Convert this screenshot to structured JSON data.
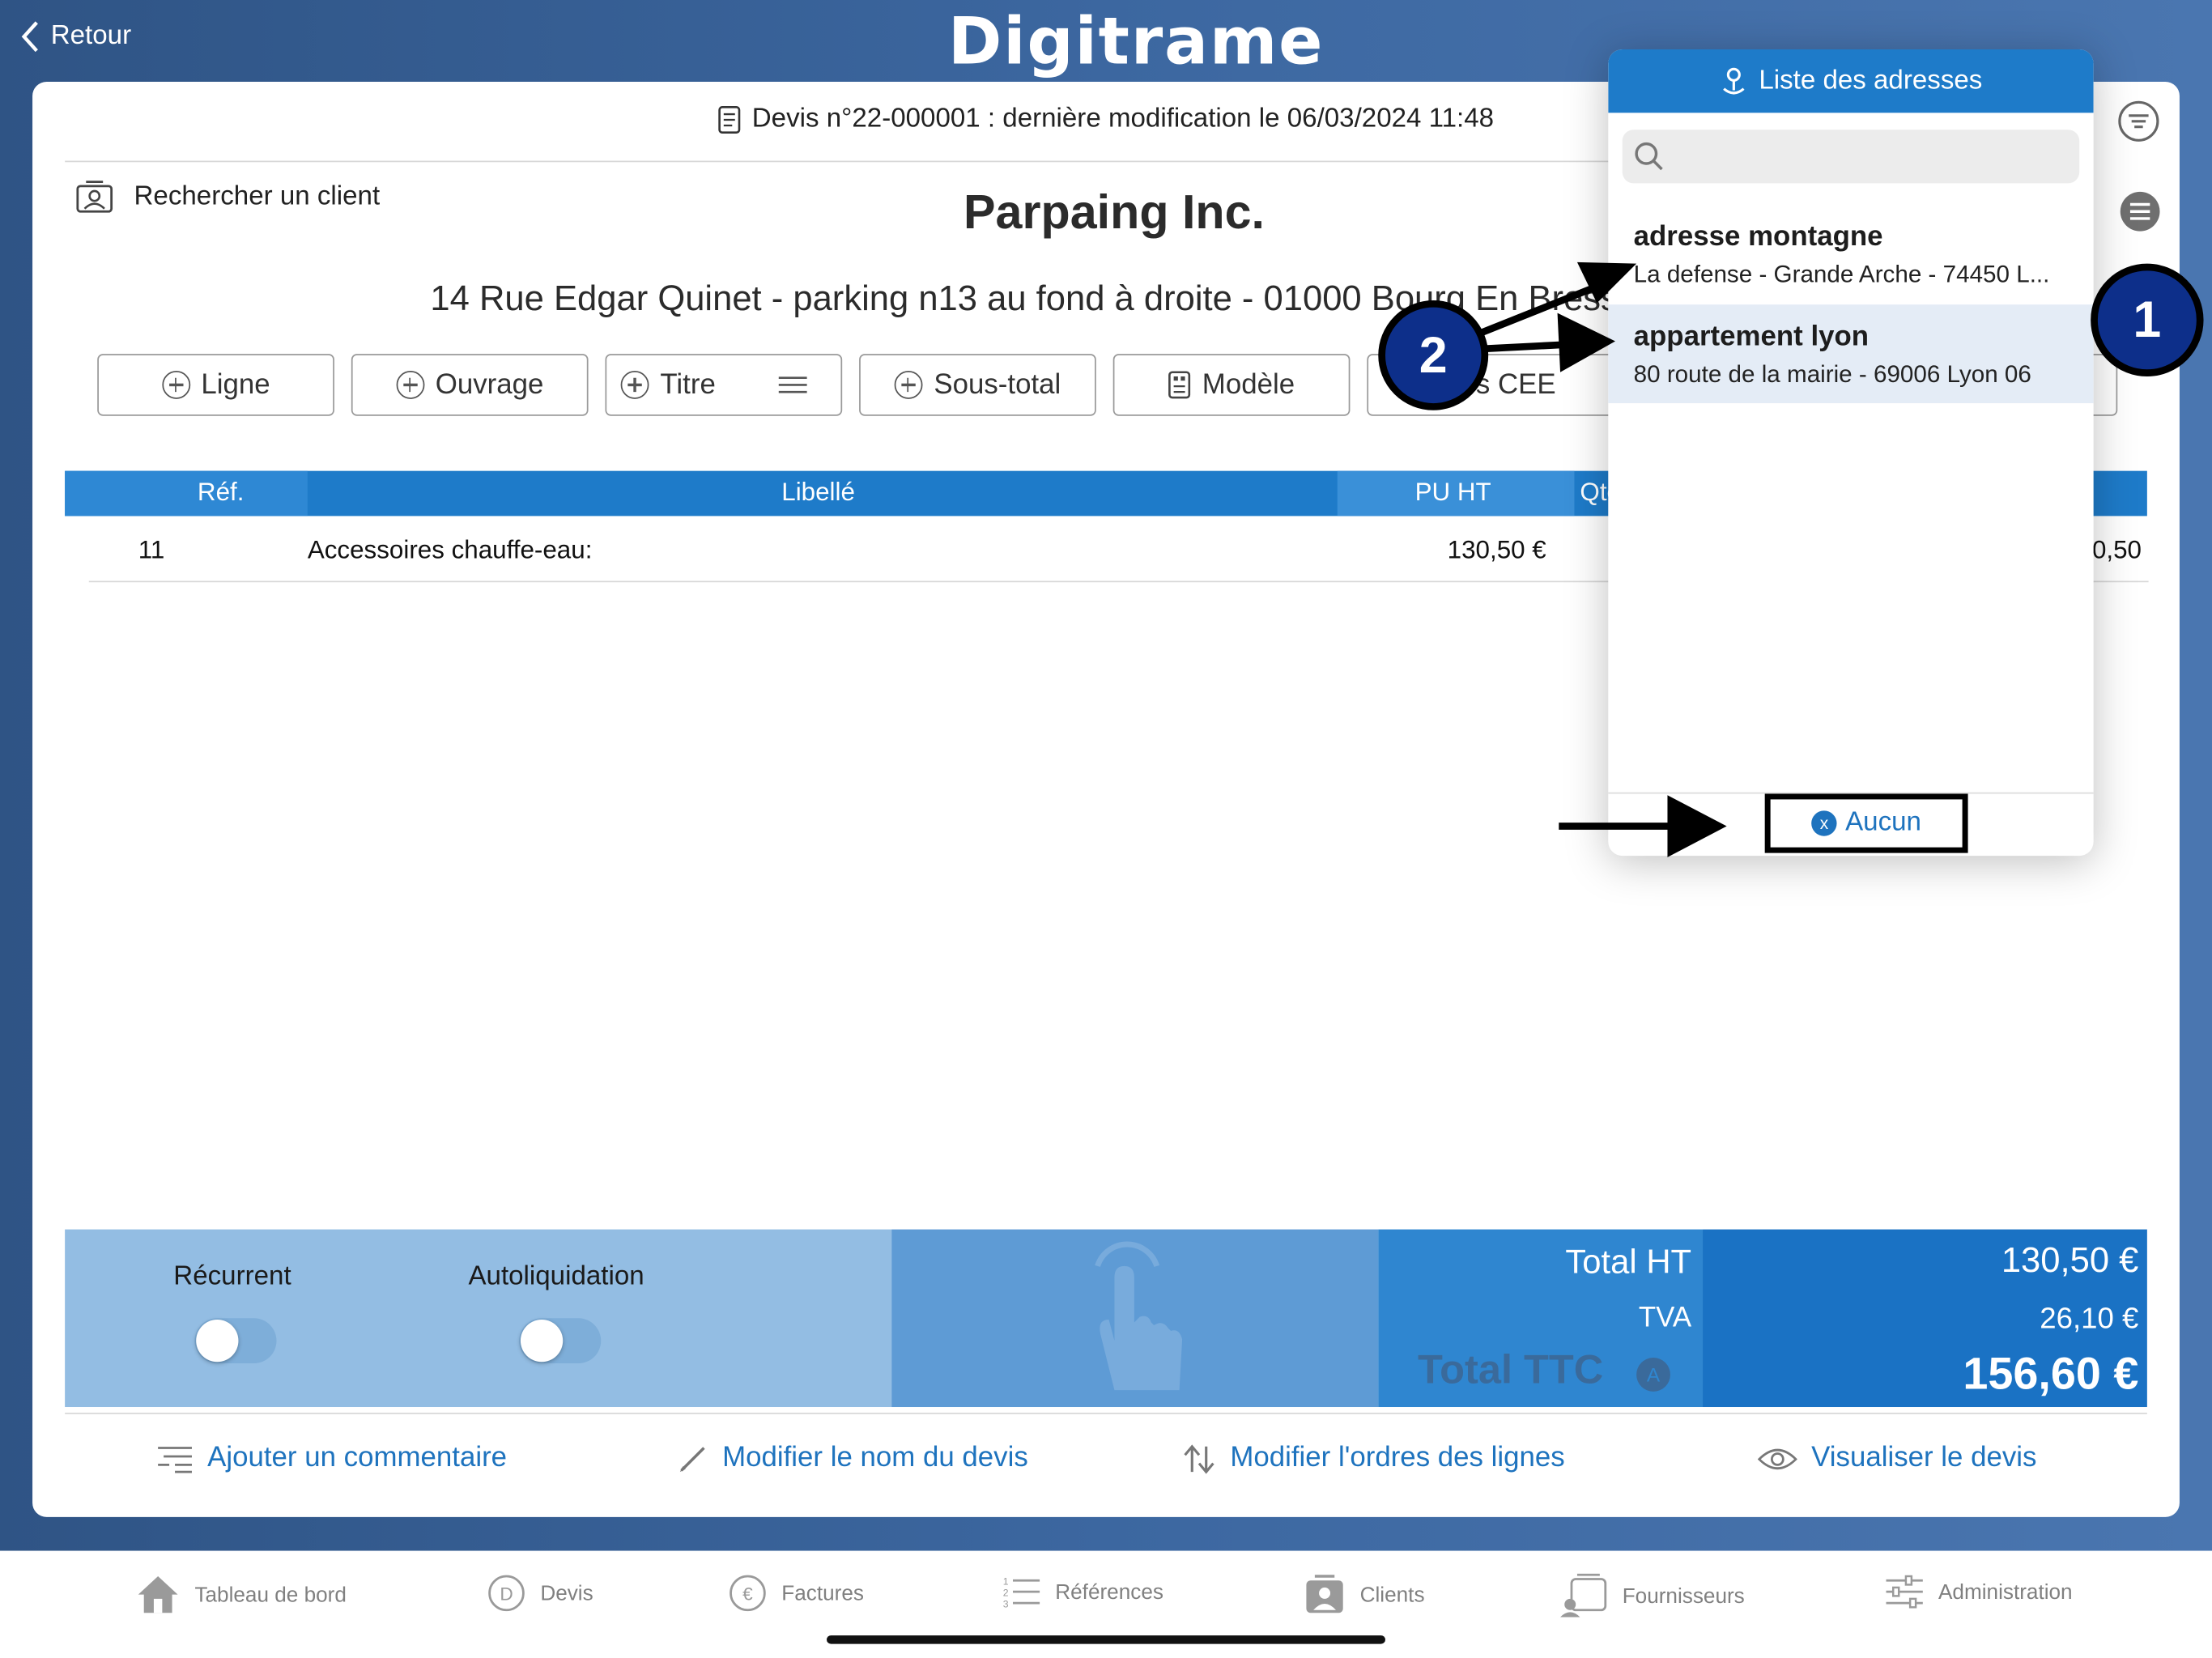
{
  "nav": {
    "back_label": "Retour",
    "app_logo": "Digitrame"
  },
  "quote": {
    "header": "Devis n°22-000001 : dernière modification le 06/03/2024 11:48"
  },
  "client": {
    "search_label": "Rechercher un client",
    "name": "Parpaing Inc.",
    "address": "14 Rue Edgar Quinet - parking n13 au fond à droite - 01000 Bourg En Bresse"
  },
  "toolbar": {
    "ligne": "Ligne",
    "ouvrage": "Ouvrage",
    "titre": "Titre",
    "sous_total": "Sous-total",
    "modele": "Modèle",
    "primes": "Primes CEE"
  },
  "table": {
    "headers": {
      "ref": "Réf.",
      "libelle": "Libellé",
      "pu_ht": "PU HT",
      "qte": "Qté"
    },
    "rows": [
      {
        "ref": "11",
        "libelle": "Accessoires chauffe-eau:",
        "pu_ht": "130,50 €",
        "total": "130,50 €"
      }
    ]
  },
  "totals": {
    "recurrent_label": "Récurrent",
    "autoliquidation_label": "Autoliquidation",
    "recurrent_on": false,
    "autoliquidation_on": false,
    "total_ht_label": "Total HT",
    "total_ht": "130,50 €",
    "tva_label": "TVA",
    "tva": "26,10 €",
    "total_ttc_label": "Total TTC",
    "total_ttc": "156,60 €"
  },
  "actions": {
    "comment": "Ajouter un commentaire",
    "rename": "Modifier le nom du devis",
    "reorder": "Modifier l'ordres des lignes",
    "preview": "Visualiser le devis"
  },
  "address_popover": {
    "title": "Liste des adresses",
    "search_placeholder": "",
    "items": [
      {
        "title": "adresse montagne",
        "subtitle": "La defense - Grande Arche - 74450 L..."
      },
      {
        "title": "appartement lyon",
        "subtitle": "80 route de la mairie - 69006 Lyon 06"
      }
    ],
    "none_label": "Aucun"
  },
  "annotations": {
    "badge1": "1",
    "badge2": "2"
  },
  "tabs": [
    {
      "label": "Tableau de bord",
      "icon": "home-icon"
    },
    {
      "label": "Devis",
      "icon": "devis-icon"
    },
    {
      "label": "Factures",
      "icon": "euro-icon"
    },
    {
      "label": "Références",
      "icon": "list-icon"
    },
    {
      "label": "Clients",
      "icon": "clients-icon"
    },
    {
      "label": "Fournisseurs",
      "icon": "suppliers-icon"
    },
    {
      "label": "Administration",
      "icon": "settings-icon"
    }
  ],
  "colors": {
    "primary": "#1e7bc9",
    "link": "#1e73be",
    "header_bg": "#2f5485",
    "annotation_badge": "#0d2f8a"
  }
}
